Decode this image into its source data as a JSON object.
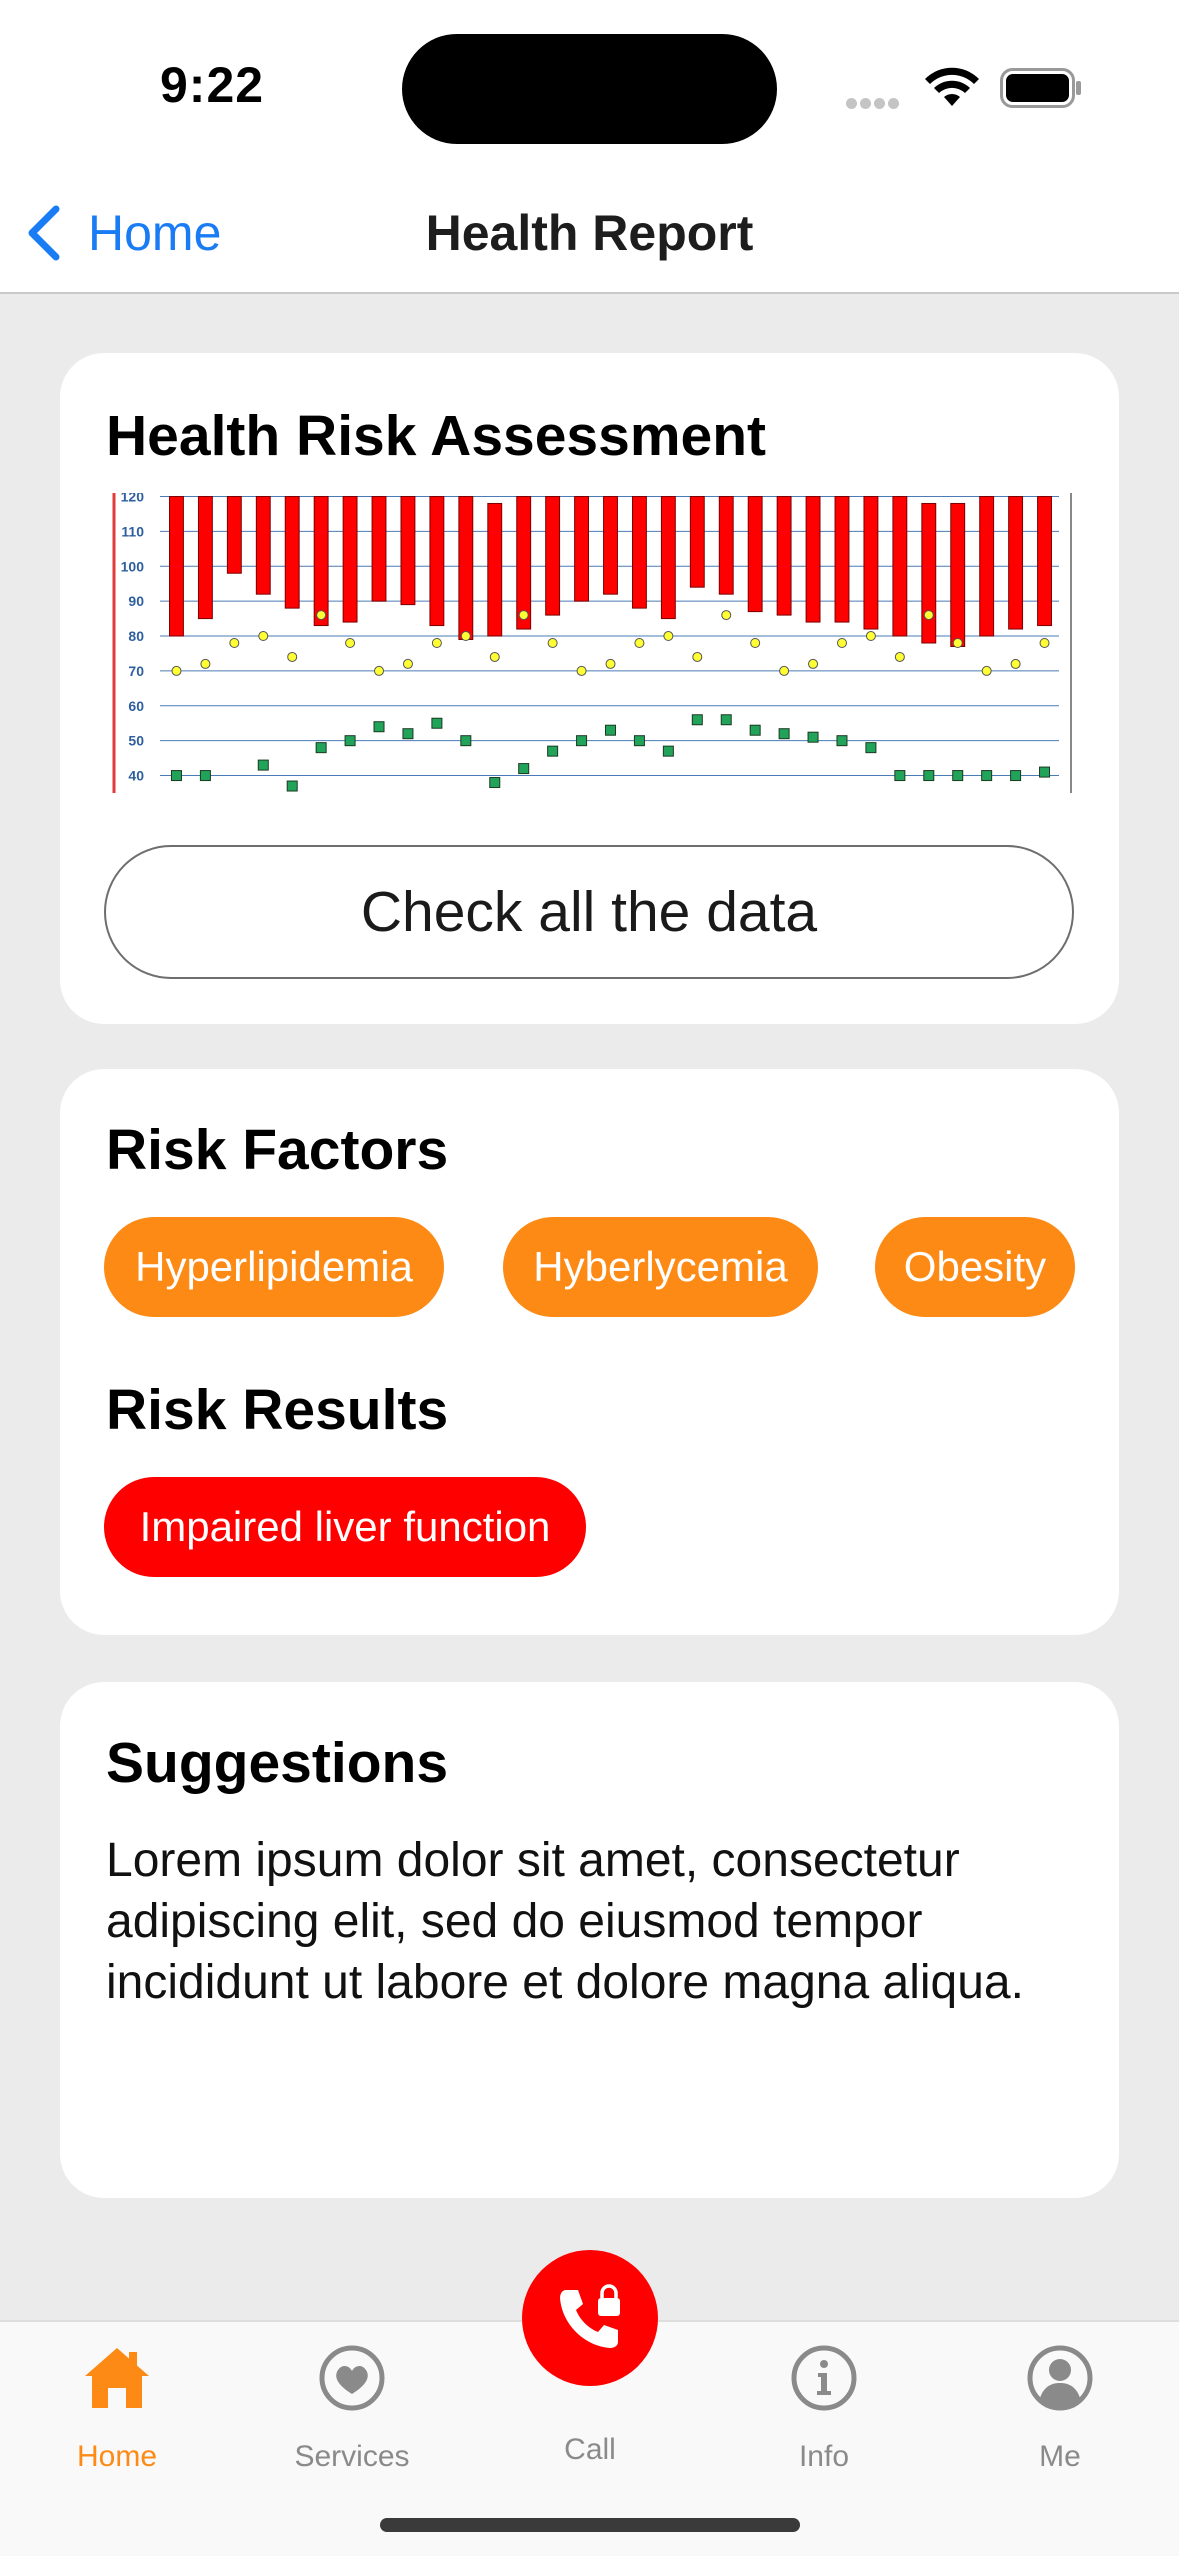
{
  "status_bar": {
    "time": "9:22"
  },
  "nav": {
    "back_label": "Home",
    "title": "Health Report"
  },
  "assessment": {
    "title": "Health Risk Assessment",
    "check_button": "Check all the data"
  },
  "chart_data": {
    "type": "bar",
    "ylim": [
      35,
      121
    ],
    "yticks": [
      40,
      50,
      60,
      70,
      80,
      90,
      100,
      110,
      120
    ],
    "grid": true,
    "bars": [
      [
        80,
        120
      ],
      [
        85,
        120
      ],
      [
        98,
        120
      ],
      [
        92,
        120
      ],
      [
        88,
        120
      ],
      [
        83,
        120
      ],
      [
        84,
        120
      ],
      [
        90,
        120
      ],
      [
        89,
        120
      ],
      [
        83,
        120
      ],
      [
        79,
        120
      ],
      [
        80,
        118
      ],
      [
        82,
        120
      ],
      [
        86,
        120
      ],
      [
        90,
        120
      ],
      [
        92,
        120
      ],
      [
        88,
        120
      ],
      [
        85,
        120
      ],
      [
        94,
        120
      ],
      [
        92,
        120
      ],
      [
        87,
        120
      ],
      [
        86,
        120
      ],
      [
        84,
        120
      ],
      [
        84,
        120
      ],
      [
        82,
        120
      ],
      [
        80,
        120
      ],
      [
        78,
        118
      ],
      [
        77,
        118
      ],
      [
        80,
        120
      ],
      [
        82,
        120
      ],
      [
        83,
        120
      ]
    ],
    "circles": [
      70,
      72,
      78,
      80,
      74,
      86,
      78,
      70,
      72,
      78,
      80,
      74,
      86,
      78,
      70,
      72,
      78,
      80,
      74,
      86,
      78,
      70,
      72,
      78,
      80,
      74,
      86,
      78,
      70,
      72,
      78
    ],
    "squares": [
      40,
      40,
      null,
      43,
      37,
      48,
      50,
      54,
      52,
      55,
      50,
      38,
      42,
      47,
      50,
      53,
      50,
      47,
      56,
      56,
      53,
      52,
      51,
      50,
      48,
      40,
      40,
      40,
      40,
      40,
      41
    ]
  },
  "risk": {
    "factors_title": "Risk Factors",
    "factors": [
      "Hyperlipidemia",
      "Hyberlycemia",
      "Obesity"
    ],
    "results_title": "Risk Results",
    "results": [
      "Impaired liver function"
    ]
  },
  "suggestions": {
    "title": "Suggestions",
    "text": "Lorem ipsum dolor sit amet, consectetur adipiscing elit, sed do eiusmod tempor incididunt ut labore et dolore magna aliqua."
  },
  "tabs": [
    {
      "label": "Home",
      "icon": "house-icon",
      "active": true
    },
    {
      "label": "Services",
      "icon": "heart-circle-icon",
      "active": false
    },
    {
      "label": "Call",
      "icon": "phone-lock-icon",
      "active": false
    },
    {
      "label": "Info",
      "icon": "info-circle-icon",
      "active": false
    },
    {
      "label": "Me",
      "icon": "person-circle-icon",
      "active": false
    }
  ],
  "colors": {
    "accent": "#fd8a15",
    "danger": "#fe0000",
    "link": "#1a7cf5",
    "bar": "#ff0000",
    "circle": "#ffff33",
    "square": "#21a35a"
  }
}
